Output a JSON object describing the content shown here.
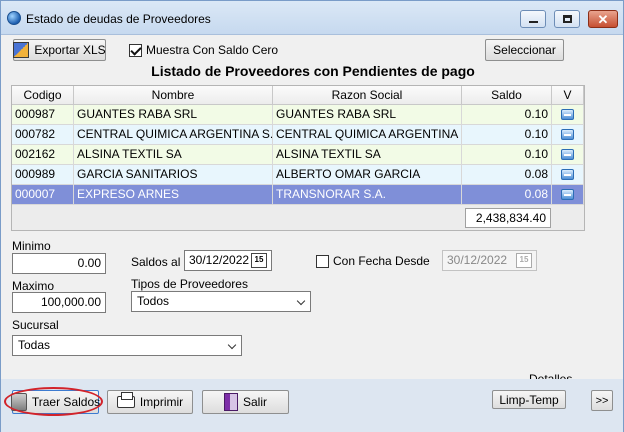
{
  "window": {
    "title": "Estado de deudas de Proveedores",
    "close_glyph": "✕"
  },
  "toolbar": {
    "export_label": "Exportar XLS",
    "show_zero_label": "Muestra Con Saldo Cero",
    "show_zero_checked": true,
    "select_label": "Seleccionar"
  },
  "heading": "Listado de Proveedores con Pendientes de pago",
  "grid": {
    "columns": [
      "Codigo",
      "Nombre",
      "Razon Social",
      "Saldo",
      "V"
    ],
    "rows": [
      {
        "codigo": "000987",
        "nombre": "GUANTES RABA SRL",
        "razon": "GUANTES RABA SRL",
        "saldo": "0.10"
      },
      {
        "codigo": "000782",
        "nombre": "CENTRAL QUIMICA ARGENTINA S.A",
        "razon": "CENTRAL QUIMICA ARGENTINA S.A",
        "saldo": "0.10"
      },
      {
        "codigo": "002162",
        "nombre": "ALSINA TEXTIL SA",
        "razon": "ALSINA TEXTIL SA",
        "saldo": "0.10"
      },
      {
        "codigo": "000989",
        "nombre": "GARCIA SANITARIOS",
        "razon": "ALBERTO OMAR GARCIA",
        "saldo": "0.08"
      },
      {
        "codigo": "000007",
        "nombre": "EXPRESO ARNES",
        "razon": "TRANSNORAR S.A.",
        "saldo": "0.08"
      }
    ],
    "selected_row": 4,
    "total": "2,438,834.40"
  },
  "filters": {
    "minimo_label": "Minimo",
    "minimo_value": "0.00",
    "saldos_al_label": "Saldos al",
    "saldos_al_value": "30/12/2022",
    "con_fecha_desde_label": "Con Fecha Desde",
    "con_fecha_desde_checked": false,
    "fecha_desde_value": "30/12/2022",
    "maximo_label": "Maximo",
    "maximo_value": "100,000.00",
    "tipos_label": "Tipos de Proveedores",
    "tipos_value": "Todos",
    "sucursal_label": "Sucursal",
    "sucursal_value": "Todas",
    "cal_glyph": "15"
  },
  "footer": {
    "traer_label": "Traer Saldos",
    "imprimir_label": "Imprimir",
    "salir_label": "Salir",
    "detalles_label": "Detalles",
    "limp_temp_label": "Limp-Temp",
    "more_label": ">>"
  },
  "icons": {
    "app": "app-globe-icon",
    "export": "excel-icon",
    "traer": "traer-saldos-icon",
    "print": "printer-icon",
    "exit": "exit-door-icon",
    "row": "row-detail-icon",
    "calendar": "calendar-icon"
  },
  "colors": {
    "selected_row": "#7f8fd8",
    "row_green": "#f2fbe6",
    "row_blue": "#e8f6fd",
    "highlight_oval": "#d2232a",
    "footer_band": "#dde6f1"
  }
}
